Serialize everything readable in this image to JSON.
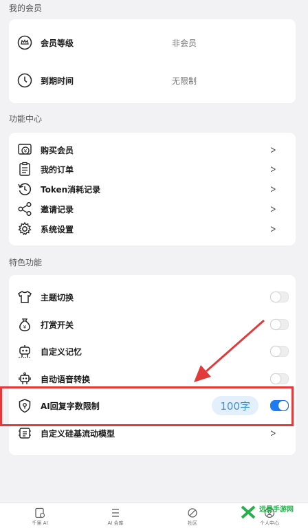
{
  "sections": {
    "my_member": "我的会员",
    "features": "功能中心",
    "special": "特色功能"
  },
  "membership": {
    "level_label": "会员等级",
    "level_value": "非会员",
    "expire_label": "到期时间",
    "expire_value": "无限制"
  },
  "feature_items": [
    {
      "label": "购买会员",
      "icon": "buy-member-icon"
    },
    {
      "label": "我的订单",
      "icon": "order-icon"
    },
    {
      "label": "Token消耗记录",
      "icon": "history-icon"
    },
    {
      "label": "邀请记录",
      "icon": "share-icon"
    },
    {
      "label": "系统设置",
      "icon": "gear-icon"
    }
  ],
  "special_items": [
    {
      "label": "主题切换",
      "icon": "tshirt-icon",
      "on": false
    },
    {
      "label": "打赏开关",
      "icon": "money-bag-icon",
      "on": false
    },
    {
      "label": "自定义记忆",
      "icon": "robot-memory-icon",
      "on": false
    },
    {
      "label": "自动语音转换",
      "icon": "robot-voice-icon",
      "on": false
    },
    {
      "label": "AI回复字数限制",
      "icon": "shield-icon",
      "on": true,
      "badge": "100字"
    },
    {
      "label": "自定义硅基流动模型",
      "icon": "model-icon"
    }
  ],
  "tabs": [
    {
      "label": "千里 AI",
      "icon": "chat-icon"
    },
    {
      "label": "AI 合库",
      "icon": "list-icon"
    },
    {
      "label": "社区",
      "icon": "leaf-icon"
    },
    {
      "label": "个人中心",
      "icon": "person-icon"
    }
  ],
  "watermark": "远景手游网",
  "colors": {
    "accent": "#1f7bf0",
    "highlight": "#e23a3a",
    "badge_bg": "#e3f0fb"
  }
}
